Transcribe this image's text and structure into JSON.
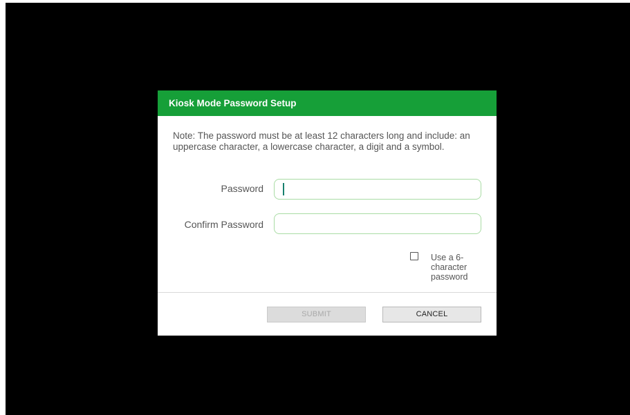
{
  "dialog": {
    "title": "Kiosk Mode Password Setup",
    "note": "Note: The password must be at least 12 characters long and include: an uppercase character, a lowercase character, a digit and a symbol.",
    "password_label": "Password",
    "password_value": "",
    "confirm_label": "Confirm Password",
    "confirm_value": "",
    "six_char_label": "Use a 6-character password",
    "six_char_checked": false,
    "submit_label": "SUBMIT",
    "cancel_label": "CANCEL"
  },
  "colors": {
    "header": "#169f38",
    "field_border": "#a9dca4",
    "background": "#000000"
  }
}
